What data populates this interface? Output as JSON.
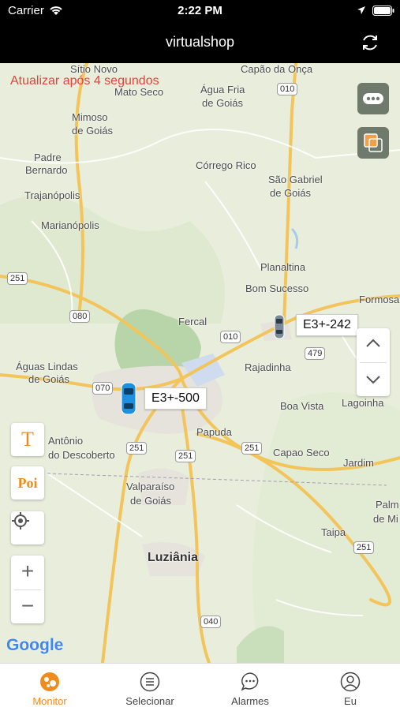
{
  "status_bar": {
    "carrier": "Carrier",
    "time": "2:22 PM"
  },
  "nav": {
    "title": "virtualshop"
  },
  "map": {
    "refresh_note": "Atualizar após 4 segundos",
    "places": {
      "sitio_novo": "Sítio Novo",
      "capao_da_onca": "Capão da Onça",
      "mato_seco": "Mato Seco",
      "agua_fria_1": "Água Fria",
      "agua_fria_2": "de Goiás",
      "mimoso_1": "Mimoso",
      "mimoso_2": "de Goiás",
      "padre_1": "Padre",
      "padre_2": "Bernardo",
      "corrego_rico": "Córrego Rico",
      "sao_gabriel_1": "São Gabriel",
      "sao_gabriel_2": "de Goiás",
      "trajanopolis": "Trajanópolis",
      "marianopolis": "Marianópolis",
      "planaltina": "Planaltina",
      "bom_sucesso": "Bom Sucesso",
      "formosa": "Formosa",
      "fercal": "Fercal",
      "aguas_lindas_1": "Águas Lindas",
      "aguas_lindas_2": "de Goiás",
      "rajadinha": "Rajadinha",
      "boa_vista": "Boa Vista",
      "lagoinha": "Lagoinha",
      "antonio_1": "Antônio",
      "antonio_2": "do Descoberto",
      "papuda": "Papuda",
      "capao_seco": "Capao Seco",
      "jardim": "Jardim",
      "valparaiso_1": "Valparaíso",
      "valparaiso_2": "de Goiás",
      "palm_1": "Palm",
      "palm_2": "de Mi",
      "taipa": "Taipa",
      "luziania": "Luziânia"
    },
    "roads": {
      "r010a": "010",
      "r251a": "251",
      "r080": "080",
      "r010b": "010",
      "r479": "479",
      "r070": "070",
      "r251b": "251",
      "r251c": "251",
      "r251d": "251",
      "r251e": "251",
      "r040": "040"
    },
    "vehicles": [
      {
        "label": "E3+-242",
        "color": "#7a8a99"
      },
      {
        "label": "E3+-500",
        "color": "#1e90e0"
      }
    ],
    "google": "Google",
    "poi_label": "Poi",
    "text_label": "T",
    "zoom_in": "+",
    "zoom_out": "−"
  },
  "tabs": [
    {
      "label": "Monitor",
      "icon": "monitor-icon",
      "active": true
    },
    {
      "label": "Selecionar",
      "icon": "list-icon",
      "active": false
    },
    {
      "label": "Alarmes",
      "icon": "chat-icon",
      "active": false
    },
    {
      "label": "Eu",
      "icon": "user-icon",
      "active": false
    }
  ],
  "colors": {
    "accent": "#f08c1e",
    "refresh_note": "#e0443c",
    "road": "#f2c45a"
  }
}
